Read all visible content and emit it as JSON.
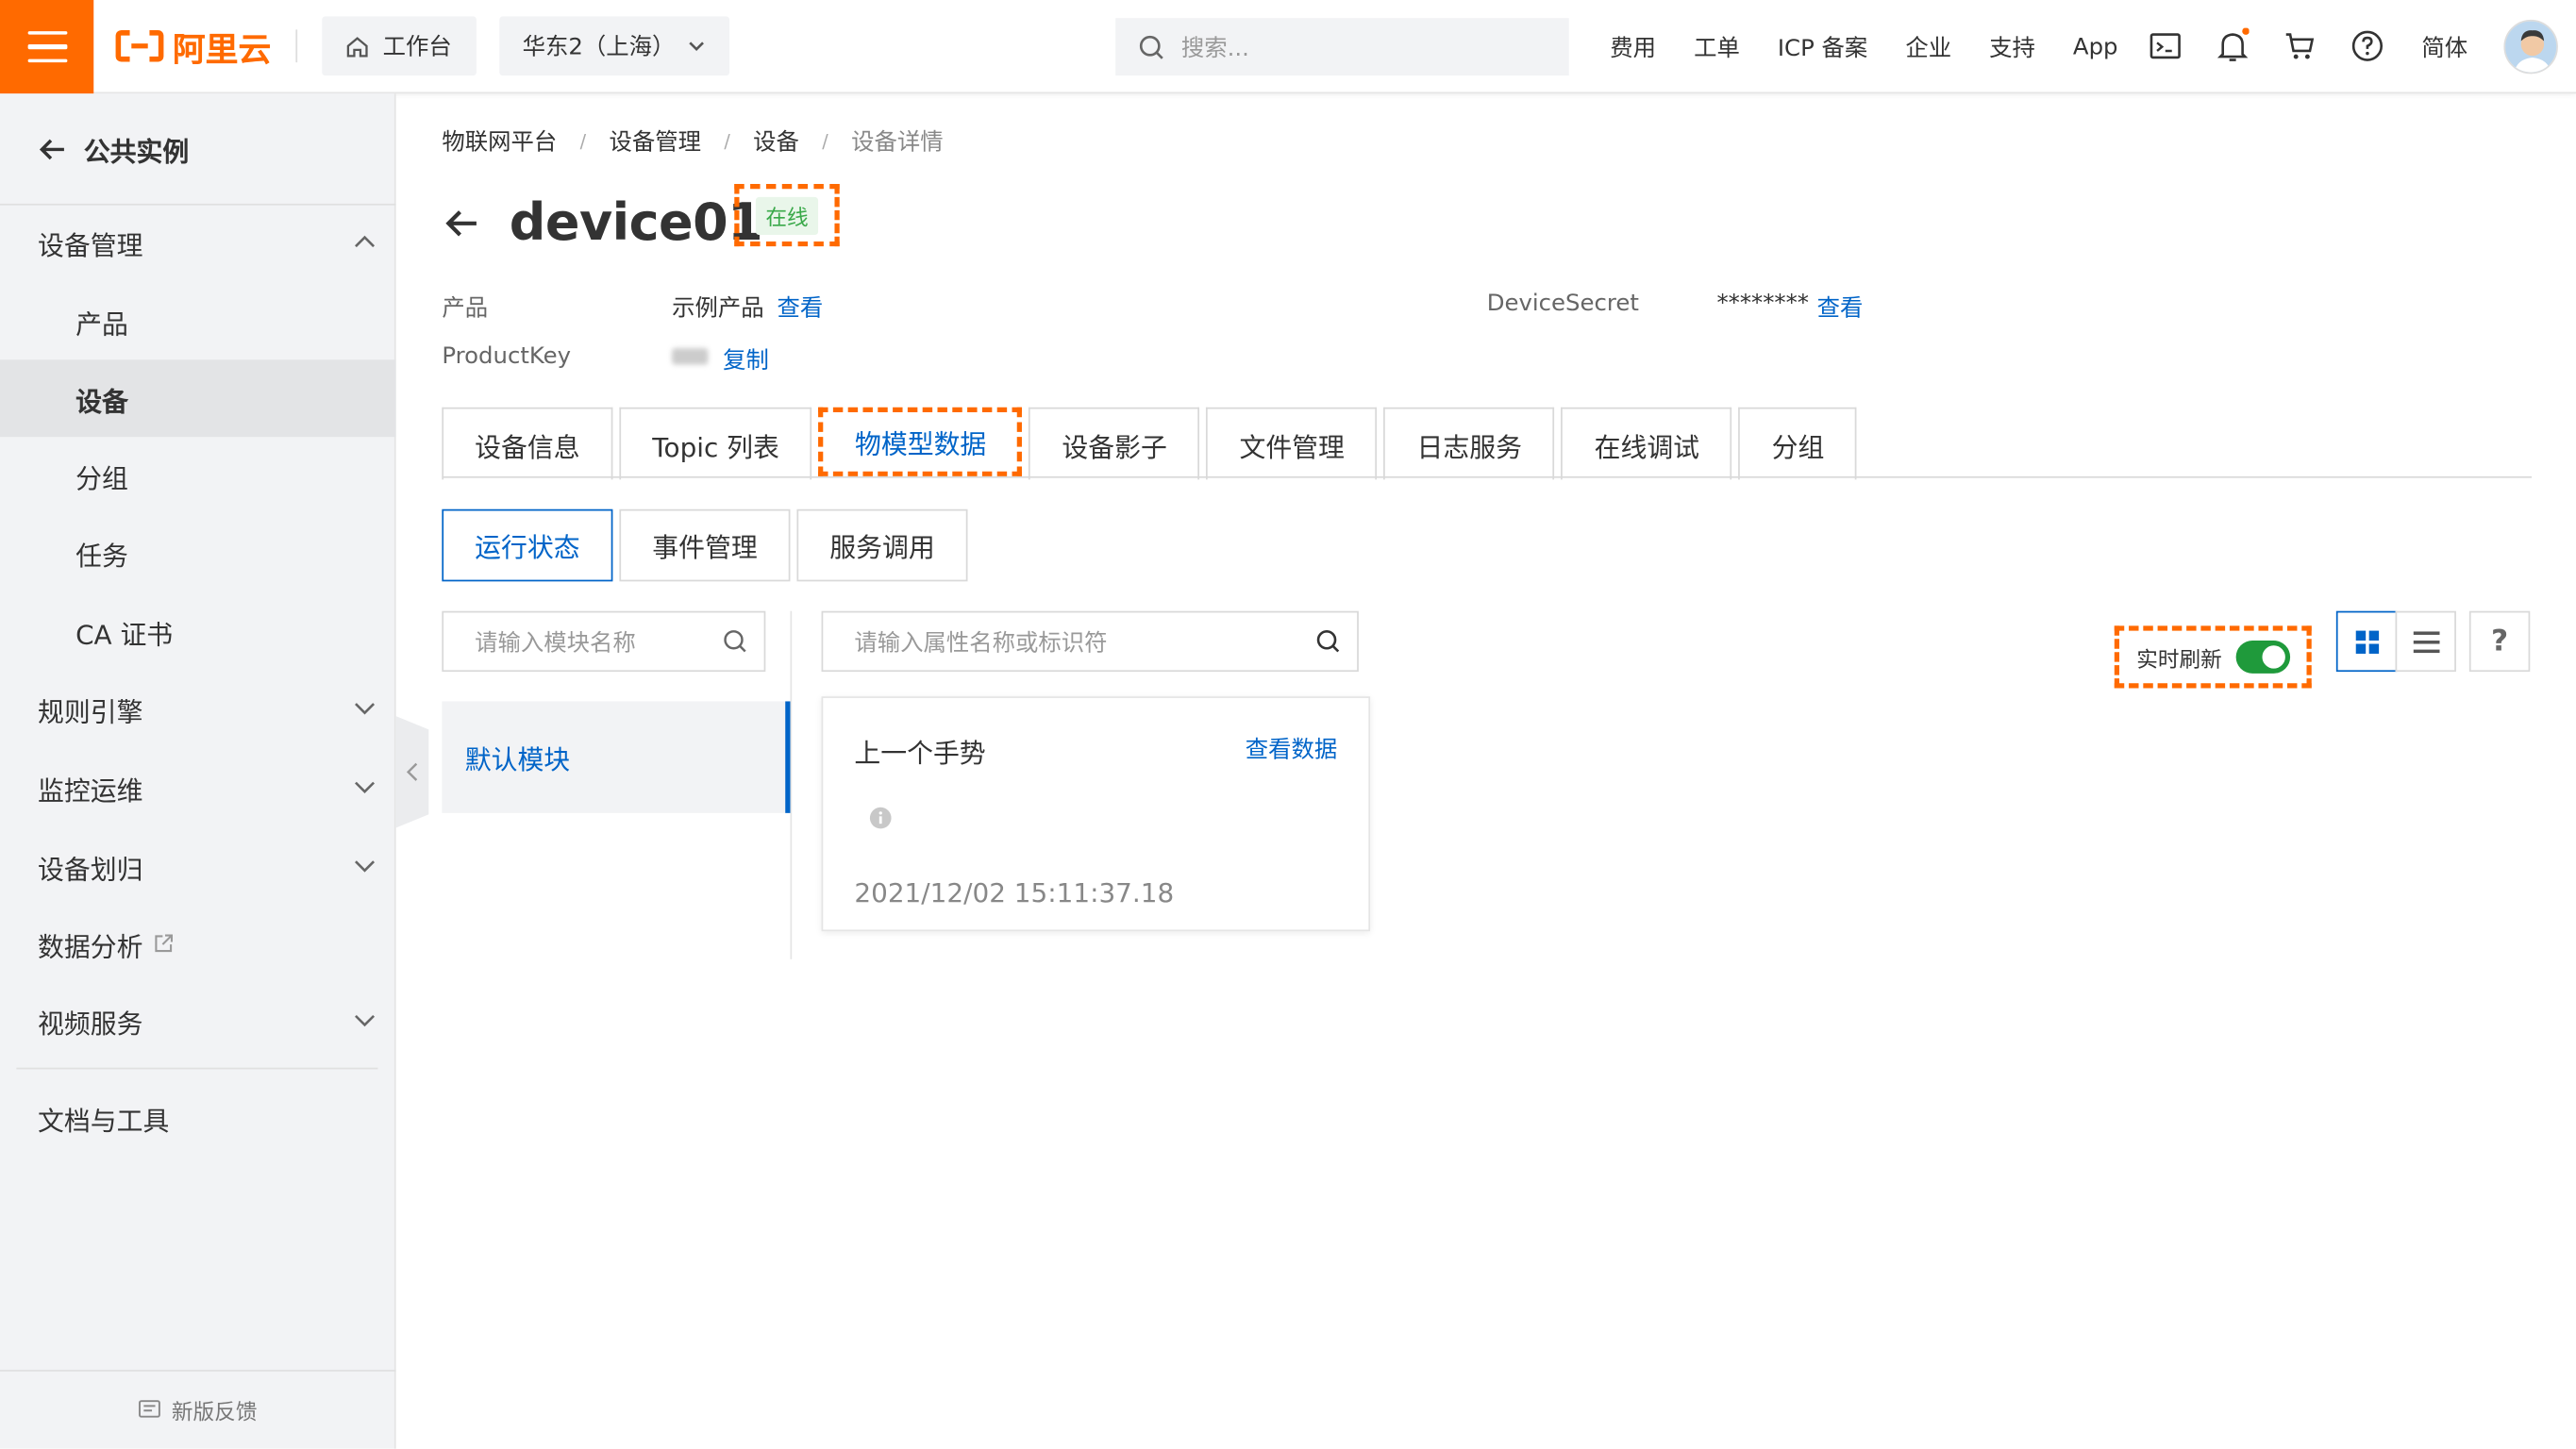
{
  "header": {
    "brand": "阿里云",
    "workbench": "工作台",
    "region": "华东2（上海）",
    "search_placeholder": "搜索...",
    "links": [
      "费用",
      "工单",
      "ICP 备案",
      "企业",
      "支持",
      "App"
    ],
    "language": "简体",
    "brand_color": "#ff6a00"
  },
  "sidebar": {
    "back_label": "公共实例",
    "device_mgmt": "设备管理",
    "product": "产品",
    "device": "设备",
    "group": "分组",
    "task": "任务",
    "ca_cert": "CA 证书",
    "rules": "规则引擎",
    "monitor": "监控运维",
    "device_assign": "设备划归",
    "data_analysis": "数据分析",
    "video": "视频服务",
    "docs": "文档与工具",
    "feedback": "新版反馈"
  },
  "breadcrumb": [
    "物联网平台",
    "设备管理",
    "设备",
    "设备详情"
  ],
  "device": {
    "name": "device01",
    "status": "在线",
    "product_label": "产品",
    "product_value": "示例产品",
    "view": "查看",
    "productkey_label": "ProductKey",
    "copy": "复制",
    "secret_label": "DeviceSecret",
    "secret_value": "********",
    "secret_view": "查看"
  },
  "tabs": [
    "设备信息",
    "Topic 列表",
    "物模型数据",
    "设备影子",
    "文件管理",
    "日志服务",
    "在线调试",
    "分组"
  ],
  "subtabs": [
    "运行状态",
    "事件管理",
    "服务调用"
  ],
  "module_search_placeholder": "请输入模块名称",
  "attr_search_placeholder": "请输入属性名称或标识符",
  "module": "默认模块",
  "card": {
    "title": "上一个手势",
    "link": "查看数据",
    "time": "2021/12/02 15:11:37.18"
  },
  "realtime_label": "实时刷新",
  "help": "?"
}
